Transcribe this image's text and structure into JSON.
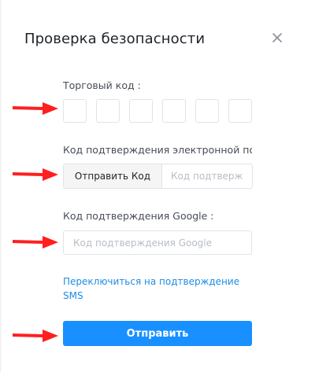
{
  "dialog": {
    "title": "Проверка безопасности",
    "close_icon": "close-icon"
  },
  "trade_code": {
    "label": "Торговый код :",
    "digits": [
      "",
      "",
      "",
      "",
      "",
      ""
    ]
  },
  "email_verification": {
    "label": "Код подтверждения электронной по",
    "send_button_label": "Отправить Код",
    "input_placeholder": "Код подтверж",
    "input_value": ""
  },
  "google_verification": {
    "label": "Код подтверждения Google :",
    "input_placeholder": "Код подтверждения Google",
    "input_value": ""
  },
  "switch_sms_link": "Переключиться на подтверждение SMS",
  "submit_button_label": "Отправить",
  "annotations": {
    "arrow_icon": "red-arrow-icon",
    "arrow_color": "#ff1f1f"
  },
  "colors": {
    "primary": "#1890ff",
    "link": "#1e8ce6",
    "border": "#e0e3e8",
    "title": "#1e2329"
  }
}
